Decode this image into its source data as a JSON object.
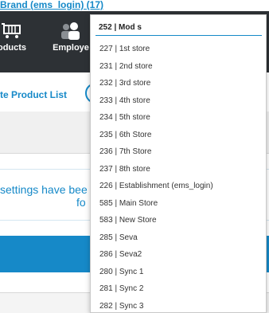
{
  "header": {
    "brand_link": "Brand (ems_login) (17)"
  },
  "nav": {
    "products_label": "oducts",
    "employees_label": "Employe",
    "products_icon": "cart-icon",
    "employees_icon": "people-icon"
  },
  "actions": {
    "update_link": "te Product List"
  },
  "alert": {
    "line1": "settings have bee",
    "line2": "fo"
  },
  "dropdown": {
    "selected": "252 | Mod s",
    "options": [
      "227 | 1st store",
      "231 | 2nd store",
      "232 | 3rd store",
      "233 | 4th store",
      "234 | 5th store",
      "235 | 6th Store",
      "236 | 7th Store",
      "237 | 8th store",
      "226 | Establishment (ems_login)",
      "585 | Main Store",
      "583 | New Store",
      "285 | Seva",
      "286 | Seva2",
      "280 | Sync 1",
      "281 | Sync 2",
      "282 | Sync 3"
    ]
  },
  "colors": {
    "accent": "#1689c8",
    "navbar": "#2d3135"
  }
}
